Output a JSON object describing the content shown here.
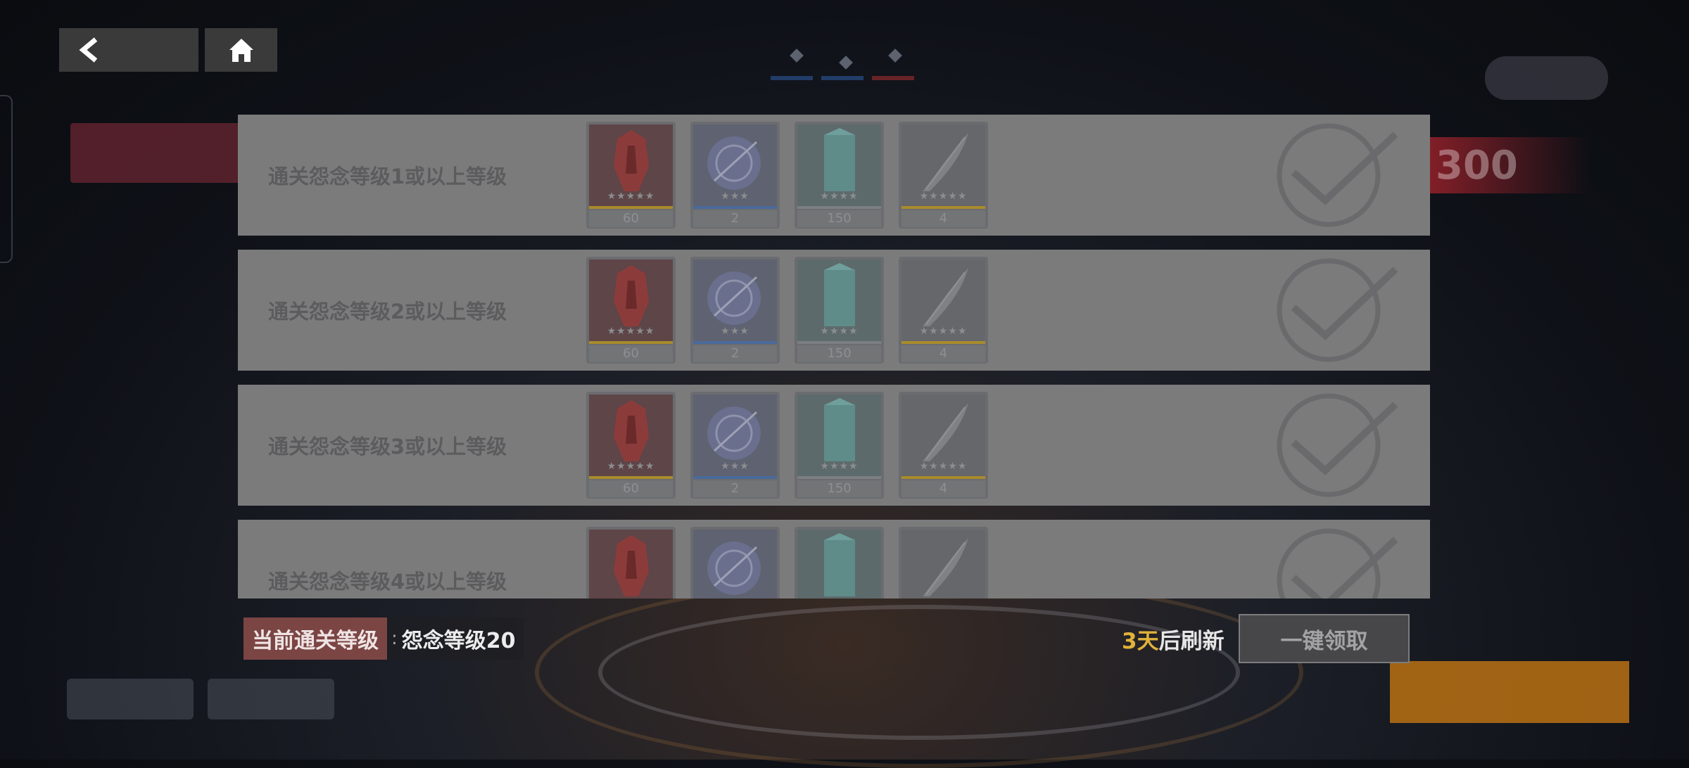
{
  "nav": {
    "back_icon": "chevron-left-icon",
    "home_icon": "home-icon"
  },
  "missions": [
    {
      "label": "通关怨念等级1或以上等级",
      "rewards": [
        {
          "icon": "red-armor-fragment",
          "stars": "★★★★★",
          "quantity": "60",
          "rarity_color": "#a98b2b"
        },
        {
          "icon": "blue-orb",
          "stars": "★★★",
          "quantity": "2",
          "rarity_color": "#4a6a9c"
        },
        {
          "icon": "cyan-crystal",
          "stars": "★★★★",
          "quantity": "150",
          "rarity_color": "#7c7e82"
        },
        {
          "icon": "white-feather",
          "stars": "★★★★★",
          "quantity": "4",
          "rarity_color": "#a98b2b"
        }
      ],
      "completed_icon": "check-circle-icon"
    },
    {
      "label": "通关怨念等级2或以上等级",
      "rewards": [
        {
          "icon": "red-armor-fragment",
          "stars": "★★★★★",
          "quantity": "60",
          "rarity_color": "#a98b2b"
        },
        {
          "icon": "blue-orb",
          "stars": "★★★",
          "quantity": "2",
          "rarity_color": "#4a6a9c"
        },
        {
          "icon": "cyan-crystal",
          "stars": "★★★★",
          "quantity": "150",
          "rarity_color": "#7c7e82"
        },
        {
          "icon": "white-feather",
          "stars": "★★★★★",
          "quantity": "4",
          "rarity_color": "#a98b2b"
        }
      ],
      "completed_icon": "check-circle-icon"
    },
    {
      "label": "通关怨念等级3或以上等级",
      "rewards": [
        {
          "icon": "red-armor-fragment",
          "stars": "★★★★★",
          "quantity": "60",
          "rarity_color": "#a98b2b"
        },
        {
          "icon": "blue-orb",
          "stars": "★★★",
          "quantity": "2",
          "rarity_color": "#4a6a9c"
        },
        {
          "icon": "cyan-crystal",
          "stars": "★★★★",
          "quantity": "150",
          "rarity_color": "#7c7e82"
        },
        {
          "icon": "white-feather",
          "stars": "★★★★★",
          "quantity": "4",
          "rarity_color": "#a98b2b"
        }
      ],
      "completed_icon": "check-circle-icon"
    },
    {
      "label": "通关怨念等级4或以上等级",
      "rewards": [
        {
          "icon": "red-armor-fragment",
          "stars": "",
          "quantity": "",
          "rarity_color": "#a98b2b"
        },
        {
          "icon": "blue-orb",
          "stars": "",
          "quantity": "",
          "rarity_color": "#4a6a9c"
        },
        {
          "icon": "cyan-crystal",
          "stars": "",
          "quantity": "",
          "rarity_color": "#7c7e82"
        },
        {
          "icon": "white-feather",
          "stars": "",
          "quantity": "",
          "rarity_color": "#a98b2b"
        }
      ],
      "completed_icon": "check-circle-icon"
    }
  ],
  "status": {
    "label": "当前通关等级",
    "separator": ":",
    "value": "怨念等级20"
  },
  "refresh": {
    "days": "3天",
    "suffix": "后刷新"
  },
  "claim_all_label": "一键领取",
  "colors": {
    "row_bg": "#7b7b7c",
    "status_label_bg": "#7b4544",
    "days_accent": "#e0b23a",
    "claim_button_bg": "#474749"
  }
}
